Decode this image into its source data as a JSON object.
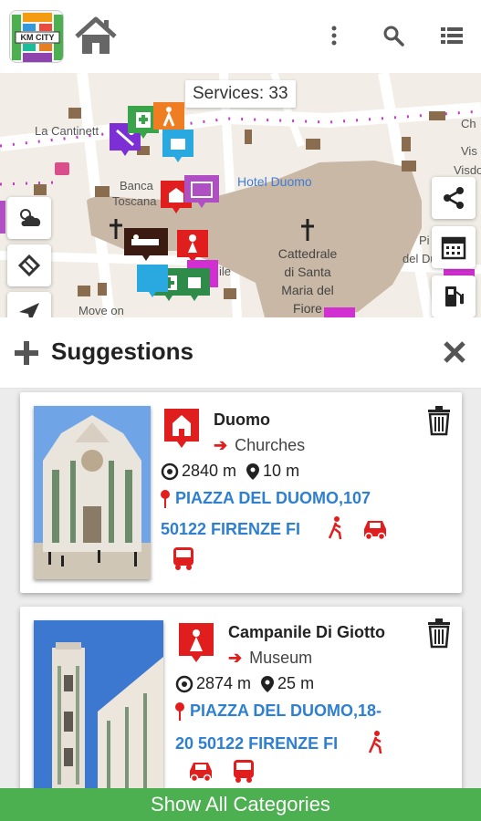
{
  "header": {
    "logo_text": "KM CITY",
    "icons": [
      "app-logo-icon",
      "home-icon",
      "more-vert-icon",
      "search-icon",
      "list-icon"
    ]
  },
  "map": {
    "services_label": "Services: 33",
    "labels": {
      "la_cantinetta": "La Cantinett",
      "hotel_duomo": "Hotel Duomo",
      "banca": "Banca",
      "toscana": "Toscana",
      "ile": "ile",
      "move_on": "Move on",
      "ch": "Ch",
      "vis": "Vis",
      "visdo": "Visdo",
      "pi": "Pi",
      "del_duomo": "del Duom"
    },
    "cathedral_lines": [
      "Cattedrale",
      "di Santa",
      "Maria del",
      "Fiore"
    ],
    "colors": {
      "road_marks": "#c23cc6",
      "cathedral": "#c9b8a5"
    }
  },
  "suggestions": {
    "title": "Suggestions",
    "items": [
      {
        "name": "Duomo",
        "category": "Churches",
        "distance": "2840 m",
        "elevation": "10 m",
        "address_line1": "PIAZZA DEL DUOMO,107",
        "address_line2": "50122 FIRENZE FI",
        "icon": "church-icon"
      },
      {
        "name": "Campanile Di Giotto",
        "category": "Museum",
        "distance": "2874 m",
        "elevation": "25 m",
        "address_line1": "PIAZZA DEL DUOMO,18-",
        "address_line2": "20 50122 FIRENZE FI",
        "icon": "museum-icon"
      }
    ]
  },
  "footer": {
    "label": "Show All Categories"
  },
  "colors": {
    "accent_red": "#e01e1e",
    "link_blue": "#2e7fd0",
    "bar_green": "#4caf50"
  }
}
